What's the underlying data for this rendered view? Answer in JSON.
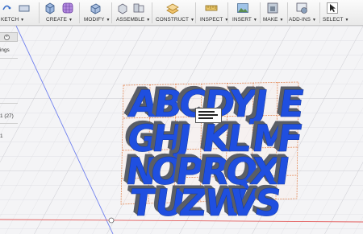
{
  "toolbar": {
    "groups": [
      {
        "id": "sketch",
        "label": "KETCH"
      },
      {
        "id": "create",
        "label": "CREATE"
      },
      {
        "id": "modify",
        "label": "MODIFY"
      },
      {
        "id": "assemble",
        "label": "ASSEMBLE"
      },
      {
        "id": "construct",
        "label": "CONSTRUCT"
      },
      {
        "id": "inspect",
        "label": "INSPECT"
      },
      {
        "id": "insert",
        "label": "INSERT"
      },
      {
        "id": "make",
        "label": "MAKE"
      },
      {
        "id": "addins",
        "label": "ADD-INS"
      },
      {
        "id": "select",
        "label": "SELECT"
      }
    ],
    "caret": "▼"
  },
  "browser": {
    "tab_close": "×",
    "item_settings": "ings",
    "item_count": "1 (27)",
    "item_one": "1"
  },
  "model": {
    "rows": [
      [
        "A",
        "B",
        "C",
        "D",
        "Y",
        "J",
        "E"
      ],
      [
        "G",
        "H",
        "J",
        "K",
        "L",
        "M",
        "F"
      ],
      [
        "N",
        "O",
        "P",
        "R",
        "Q",
        "X",
        "I"
      ],
      [
        "T",
        "U",
        "Z",
        "W",
        "V",
        "S"
      ]
    ],
    "letter_color": "#1f4fe0",
    "side_color": "#5a5e66"
  },
  "colors": {
    "grid": "#d8d8dc",
    "axis_blue": "#6f7ff0",
    "axis_red": "#e05050",
    "sketch_orange": "#e0703a"
  }
}
